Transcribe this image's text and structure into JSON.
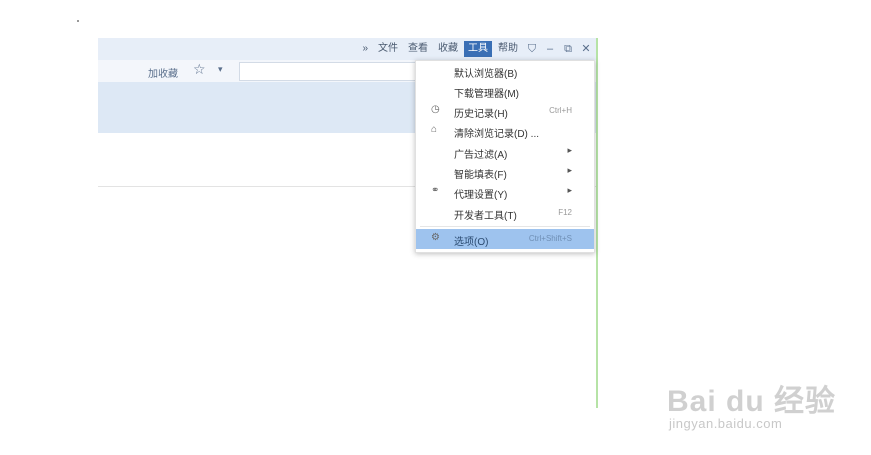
{
  "menubar": {
    "overflow": "»",
    "items": [
      "文件",
      "查看",
      "收藏",
      "工具",
      "帮助"
    ],
    "active_index": 3
  },
  "toolbar": {
    "favorites_label": "加收藏",
    "star_icon": "☆",
    "dropdown_icon": "▾"
  },
  "tools_menu": {
    "items": [
      {
        "label": "默认浏览器(B)",
        "shortcut": "",
        "icon": "",
        "has_submenu": false
      },
      {
        "label": "下载管理器(M)",
        "shortcut": "",
        "icon": "",
        "has_submenu": false
      },
      {
        "label": "历史记录(H)",
        "shortcut": "Ctrl+H",
        "icon": "◷",
        "has_submenu": false
      },
      {
        "label": "清除浏览记录(D) ...",
        "shortcut": "",
        "icon": "⌂",
        "has_submenu": false
      },
      {
        "label": "广告过滤(A)",
        "shortcut": "",
        "icon": "",
        "has_submenu": true
      },
      {
        "label": "智能填表(F)",
        "shortcut": "",
        "icon": "",
        "has_submenu": true
      },
      {
        "label": "代理设置(Y)",
        "shortcut": "",
        "icon": "⚭",
        "has_submenu": true
      },
      {
        "label": "开发者工具(T)",
        "shortcut": "F12",
        "icon": "",
        "has_submenu": false
      },
      {
        "label": "选项(O)",
        "shortcut": "Ctrl+Shift+S",
        "icon": "⚙",
        "has_submenu": false,
        "highlighted": true
      }
    ]
  },
  "watermark": {
    "logo": "Bai du 经验",
    "url": "jingyan.baidu.com"
  }
}
